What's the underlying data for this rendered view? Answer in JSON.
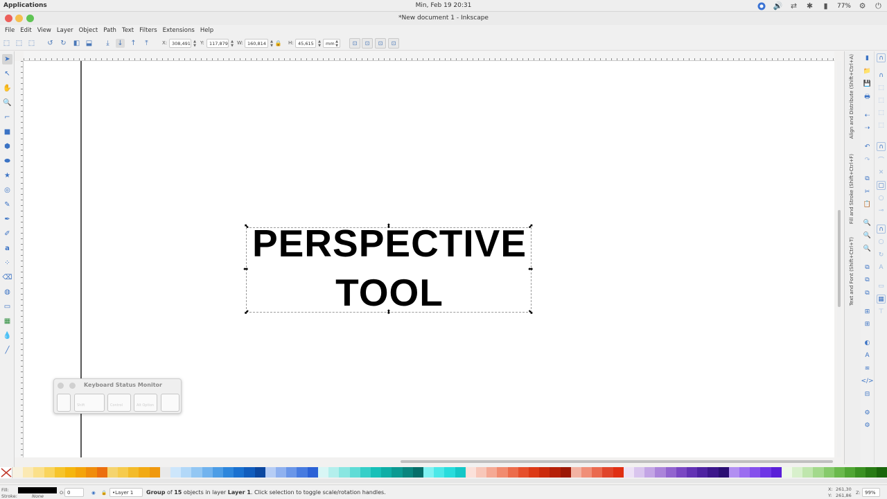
{
  "system_bar": {
    "applications": "Applications",
    "clock": "Min, Feb 19    20:31",
    "battery": "77%"
  },
  "window": {
    "title": "*New document 1 - Inkscape"
  },
  "menu": [
    "File",
    "Edit",
    "View",
    "Layer",
    "Object",
    "Path",
    "Text",
    "Filters",
    "Extensions",
    "Help"
  ],
  "tool_controls": {
    "x_label": "X:",
    "x_value": "308,491",
    "y_label": "Y:",
    "y_value": "117,879",
    "w_label": "W:",
    "w_value": "160,814",
    "h_label": "H:",
    "h_value": "45,615",
    "unit": "mm"
  },
  "canvas": {
    "text_line1": "PERSPECTIVE",
    "text_line2": "TOOL"
  },
  "keyboard_monitor": {
    "title": "Keyboard Status Monitor",
    "keys": [
      "",
      "Shift",
      "Control",
      "Alt Option",
      ""
    ]
  },
  "dock_tabs": {
    "align": "Align and Distribute (Shift+Ctrl+A)",
    "fill_stroke": "Fill and Stroke (Shift+Ctrl+F)",
    "text_font": "Text and Font (Shift+Ctrl+T)"
  },
  "palette_colors": [
    "#f7f2e2",
    "#fbe9b3",
    "#fbe08a",
    "#f9d45c",
    "#f6c42b",
    "#f5b60f",
    "#f4a40b",
    "#f08d0c",
    "#ec6f0e",
    "#f5d46e",
    "#f6cb4d",
    "#f3bb2a",
    "#f2aa14",
    "#f0990f",
    "#e9e9e9",
    "#cde6fb",
    "#b2d8f8",
    "#93c7f3",
    "#71b3ee",
    "#4c9de6",
    "#2d86dc",
    "#1a71d0",
    "#115dbd",
    "#0c48a0",
    "#b6cdf5",
    "#8fb1ef",
    "#6a96e8",
    "#477be0",
    "#2b62d6",
    "#d8f6f5",
    "#b3efec",
    "#8ae6e1",
    "#5fdcd6",
    "#36cfc8",
    "#17c0b8",
    "#0faea6",
    "#0c9a92",
    "#0a857e",
    "#066e69",
    "#7ff2f2",
    "#4ce8e8",
    "#28dcdc",
    "#15c7c7",
    "#fbe1da",
    "#f8c7b9",
    "#f5a994",
    "#f18b6f",
    "#ec6c4b",
    "#e64f2c",
    "#dc3916",
    "#cb2a0c",
    "#b52008",
    "#9c1806",
    "#f3b3a3",
    "#f08f78",
    "#ea6a4f",
    "#e0452b",
    "#e02f14",
    "#ede2f6",
    "#d9c5ee",
    "#c3a5e5",
    "#ab84da",
    "#9264cf",
    "#7a47c3",
    "#6332b4",
    "#4e22a1",
    "#3c168b",
    "#2b0e73",
    "#b28ff2",
    "#9b6df0",
    "#8550ec",
    "#6e35e6",
    "#5a1fd8",
    "#eef8e8",
    "#d8f0cc",
    "#bfe6ad",
    "#a3d98c",
    "#86ca6b",
    "#6ab94c",
    "#50a634",
    "#3a9122",
    "#287b15",
    "#1a650b"
  ],
  "status_bar": {
    "fill_label": "Fill:",
    "stroke_label": "Stroke:",
    "stroke_value": "None",
    "opacity_label": "O:",
    "opacity_value": "0",
    "layer": "•Layer 1",
    "msg_group": "Group",
    "msg_of": " of ",
    "msg_count": "15",
    "msg_objects": " objects in layer ",
    "msg_layer": "Layer 1",
    "msg_tail": ". Click selection to toggle scale/rotation handles.",
    "coord_x": "261,30",
    "coord_y": "261,86",
    "zoom_label": "Z:",
    "zoom": "99%"
  }
}
